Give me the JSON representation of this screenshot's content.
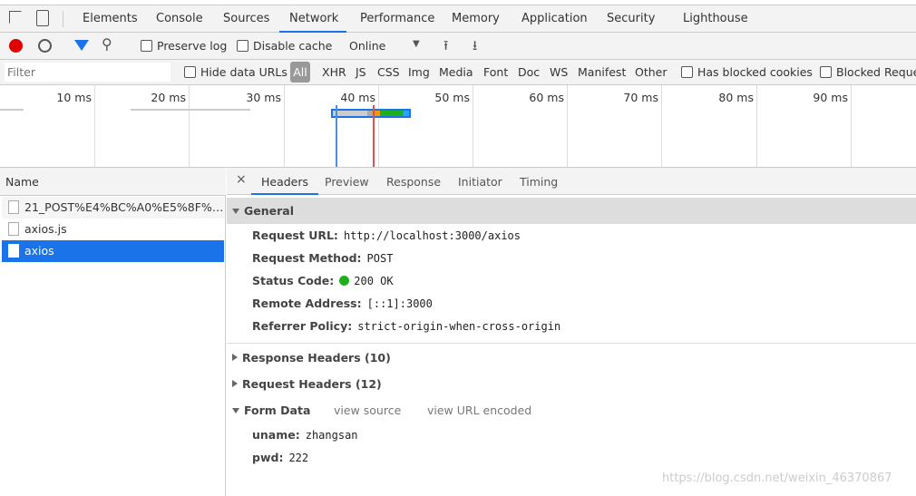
{
  "tabs": [
    "Elements",
    "Console",
    "Sources",
    "Network",
    "Performance",
    "Memory",
    "Application",
    "Security",
    "Lighthouse"
  ],
  "active_tab": "Network",
  "toolbar": {
    "preserve_log": "Preserve log",
    "disable_cache": "Disable cache",
    "throttle": "Online"
  },
  "filter": {
    "placeholder": "Filter",
    "hide_data_urls": "Hide data URLs",
    "all": "All",
    "types": [
      "XHR",
      "JS",
      "CSS",
      "Img",
      "Media",
      "Font",
      "Doc",
      "WS",
      "Manifest",
      "Other"
    ],
    "blocked_cookies": "Has blocked cookies",
    "blocked_requests": "Blocked Reque"
  },
  "timeline": {
    "ticks": [
      "10 ms",
      "20 ms",
      "30 ms",
      "40 ms",
      "50 ms",
      "60 ms",
      "70 ms",
      "80 ms",
      "90 ms",
      "10"
    ],
    "request_bar_ms": {
      "start": 35,
      "end": 43.5
    },
    "dom_content_loaded_ms": 35.5,
    "load_ms": 39.4,
    "colors": {
      "dcl": "#4a90e2",
      "load": "#e05050"
    }
  },
  "requests": {
    "header": "Name",
    "items": [
      "21_POST%E4%BC%A0%E5%8F%8...",
      "axios.js",
      "axios"
    ],
    "selected": 2
  },
  "detail": {
    "close": "×",
    "tabs": [
      "Headers",
      "Preview",
      "Response",
      "Initiator",
      "Timing"
    ],
    "active": "Headers",
    "general": {
      "title": "General",
      "rows": [
        {
          "key": "Request URL:",
          "value": "http://localhost:3000/axios"
        },
        {
          "key": "Request Method:",
          "value": "POST"
        },
        {
          "key": "Status Code:",
          "value": "200 OK"
        },
        {
          "key": "Remote Address:",
          "value": "[::1]:3000"
        },
        {
          "key": "Referrer Policy:",
          "value": "strict-origin-when-cross-origin"
        }
      ]
    },
    "response_headers": "Response Headers (10)",
    "request_headers": "Request Headers (12)",
    "form_data": {
      "title": "Form Data",
      "view_source": "view source",
      "view_url_encoded": "view URL encoded",
      "rows": [
        {
          "key": "uname:",
          "value": "zhangsan"
        },
        {
          "key": "pwd:",
          "value": "222"
        }
      ]
    }
  },
  "watermark": "https://blog.csdn.net/weixin_46370867"
}
